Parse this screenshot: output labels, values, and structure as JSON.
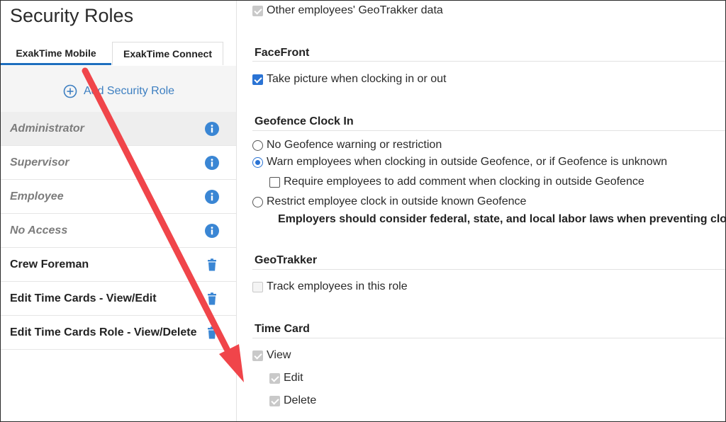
{
  "page_title": "Security Roles",
  "tabs": [
    {
      "label": "ExakTime Mobile",
      "active": true
    },
    {
      "label": "ExakTime Connect",
      "active": false
    }
  ],
  "add_role_label": "Add Security Role",
  "roles": [
    {
      "label": "Administrator",
      "kind": "system",
      "icon": "info-icon"
    },
    {
      "label": "Supervisor",
      "kind": "system",
      "icon": "info-icon"
    },
    {
      "label": "Employee",
      "kind": "system",
      "icon": "info-icon"
    },
    {
      "label": "No Access",
      "kind": "system",
      "icon": "info-icon"
    },
    {
      "label": "Crew Foreman",
      "kind": "custom",
      "icon": "trash-icon"
    },
    {
      "label": "Edit Time Cards - View/Edit",
      "kind": "custom",
      "icon": "trash-icon"
    },
    {
      "label": "Edit Time Cards Role - View/Delete",
      "kind": "custom",
      "icon": "trash-icon"
    }
  ],
  "settings": {
    "other_geotrakker": {
      "label": "Other employees' GeoTrakker data",
      "checked": true,
      "disabled": true
    },
    "facefront": {
      "title": "FaceFront",
      "take_picture": {
        "label": "Take picture when clocking in or out",
        "checked": true
      }
    },
    "geofence": {
      "title": "Geofence Clock In",
      "no_warning": {
        "label": "No Geofence warning or restriction",
        "selected": false
      },
      "warn": {
        "label": "Warn employees when clocking in outside Geofence, or if Geofence is unknown",
        "selected": true
      },
      "require_comment": {
        "label": "Require employees to add comment when clocking in outside Geofence",
        "checked": false
      },
      "restrict": {
        "label": "Restrict employee clock in outside known Geofence",
        "selected": false
      },
      "note": "Employers should consider federal, state, and local labor laws when preventing clock in"
    },
    "geotrakker": {
      "title": "GeoTrakker",
      "track": {
        "label": "Track employees in this role",
        "checked": false,
        "disabled": true
      }
    },
    "time_card": {
      "title": "Time Card",
      "view": {
        "label": "View",
        "checked": true,
        "disabled": true
      },
      "edit": {
        "label": "Edit",
        "checked": true,
        "disabled": true
      },
      "delete": {
        "label": "Delete",
        "checked": true,
        "disabled": true
      }
    }
  },
  "colors": {
    "accent": "#2a73d4",
    "link": "#3d7fc1",
    "annotation_arrow": "#f0454a"
  }
}
